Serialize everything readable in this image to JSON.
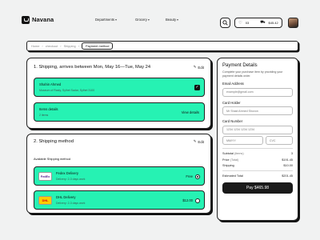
{
  "header": {
    "brand": "Navana",
    "nav": [
      "Departments",
      "Grocery",
      "Beauty"
    ],
    "cart_count": "03",
    "cart_total": "$45.42"
  },
  "breadcrumb": [
    "Home",
    "checkout",
    "Shipping",
    "Payment method"
  ],
  "shipping_section": {
    "title": "1. Shipping, arrives between Mon, May 16—Tue, May 24",
    "edit": "Edit",
    "recipient": {
      "name": "Shahin Ahmed",
      "address": "Museum of Rasty, Sylhet Sadar, Sylhet 3100"
    },
    "items": {
      "label": "Items details",
      "count": "2 items",
      "link": "View details"
    }
  },
  "method_section": {
    "title": "2. Shipping method",
    "edit": "Edit",
    "subtitle": "Available Shipping method",
    "options": [
      {
        "logo": "FedEx",
        "name": "Fedex Delivery",
        "eta": "Delivery: 2-3 days work",
        "price": "Free",
        "selected": true
      },
      {
        "logo": "DHL",
        "name": "DHL Delivery",
        "eta": "Delivery: 2-3 days work",
        "price": "$12.00",
        "selected": false
      }
    ]
  },
  "payment": {
    "title": "Payment Details",
    "subtitle": "Complete your purchase item by providing your payment details order.",
    "email_label": "Email Address",
    "email_placeholder": "example@gmail.com",
    "holder_label": "Card Holder",
    "holder_placeholder": "Mr Shaid Ahmed Shovon",
    "number_label": "Card Number",
    "number_placeholder": "1234 1234 1234 1234",
    "date_placeholder": "MM/YY",
    "cvc_placeholder": "CVC",
    "summary": [
      {
        "label": "Subtotal",
        "sub": "(items)",
        "value": "3"
      },
      {
        "label": "Price",
        "sub": "(Total)",
        "value": "$191.45"
      },
      {
        "label": "Shipping",
        "sub": "",
        "value": "$10.00"
      }
    ],
    "estimated_label": "Estimated Total",
    "estimated_value": "$201.45",
    "pay_button": "Pay $465.98"
  },
  "colors": {
    "accent": "#26f2b3",
    "dark": "#1a1a1a"
  }
}
